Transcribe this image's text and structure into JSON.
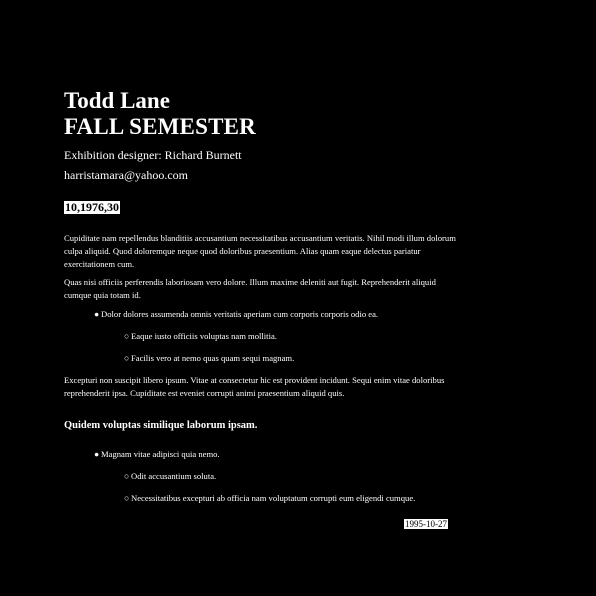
{
  "header": {
    "name": "Todd Lane",
    "subtitle": "FALL SEMESTER",
    "designer": "Exhibition designer: Richard Burnett",
    "email": "harristamara@yahoo.com",
    "code": "10,1976,30"
  },
  "body": {
    "paragraph1": "Cupiditate nam repellendus blanditiis accusantium necessitatibus accusantium veritatis. Nihil modi illum dolorum culpa aliquid. Quod doloremque neque quod doloribus praesentium. Alias quam eaque delectus pariatur exercitationem cum.",
    "paragraph2": "Quas nisi officiis perferendis laboriosam vero dolore. Illum maxime deleniti aut fugit. Reprehenderit aliquid cumque quia totam id.",
    "list1": {
      "item": "Dolor dolores assumenda omnis veritatis aperiam cum corporis corporis odio ea.",
      "subitems": [
        "Eaque iusto officiis voluptas nam mollitia.",
        "Facilis vero at nemo quas quam sequi magnam."
      ]
    },
    "paragraph3": "Excepturi non suscipit libero ipsum. Vitae at consectetur hic est provident incidunt. Sequi enim vitae doloribus reprehenderit ipsa. Cupiditate est eveniet corrupti animi praesentium aliquid quis.",
    "section_heading": "Quidem voluptas similique laborum ipsam.",
    "list2": {
      "item": "Magnam vitae adipisci quia nemo.",
      "subitems": [
        "Odit accusantium soluta.",
        "Necessitatibus excepturi ab officia nam voluptatum corrupti eum eligendi cumque."
      ]
    }
  },
  "bullets": {
    "filled": "●",
    "hollow": "○"
  },
  "footer": {
    "date": "1995-10-27"
  }
}
